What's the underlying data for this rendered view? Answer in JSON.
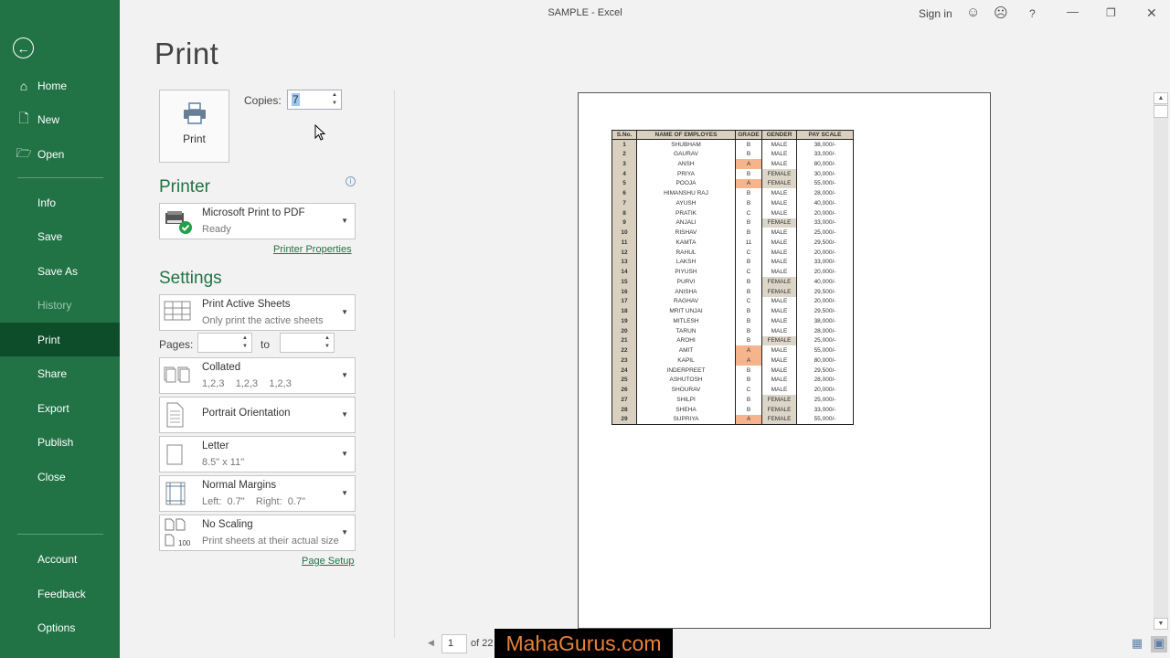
{
  "window": {
    "title": "SAMPLE  -  Excel",
    "sign_in": "Sign in",
    "icons": [
      "smiley-icon",
      "frown-icon",
      "help-icon",
      "minimize-icon",
      "restore-icon",
      "close-icon"
    ],
    "help_glyph": "?"
  },
  "sidebar": {
    "back_label": "Back",
    "items": [
      {
        "label": "Home",
        "icon": "home-icon"
      },
      {
        "label": "New",
        "icon": "new-document-icon"
      },
      {
        "label": "Open",
        "icon": "open-folder-icon"
      },
      {
        "label": "Info"
      },
      {
        "label": "Save"
      },
      {
        "label": "Save As"
      },
      {
        "label": "History",
        "disabled": true
      },
      {
        "label": "Print",
        "active": true
      },
      {
        "label": "Share"
      },
      {
        "label": "Export"
      },
      {
        "label": "Publish"
      },
      {
        "label": "Close"
      },
      {
        "label": "Account"
      },
      {
        "label": "Feedback"
      },
      {
        "label": "Options"
      }
    ]
  },
  "print": {
    "title": "Print",
    "print_button": "Print",
    "copies_label": "Copies:",
    "copies_value": "7",
    "printer_heading": "Printer",
    "printer_name": "Microsoft Print to PDF",
    "printer_status": "Ready",
    "printer_properties": "Printer Properties",
    "settings_heading": "Settings",
    "settings": {
      "scope": {
        "title": "Print Active Sheets",
        "sub": "Only print the active sheets"
      },
      "pages_label": "Pages:",
      "pages_from": "",
      "to_label": "to",
      "pages_to": "",
      "collate": {
        "title": "Collated",
        "sub": "1,2,3    1,2,3    1,2,3"
      },
      "orientation": {
        "title": "Portrait Orientation"
      },
      "paper": {
        "title": "Letter",
        "sub": "8.5\" x 11\""
      },
      "margins": {
        "title": "Normal Margins",
        "sub": "Left:  0.7\"    Right:  0.7\""
      },
      "scaling": {
        "title": "No Scaling",
        "sub": "Print sheets at their actual size",
        "icon_label": "100"
      }
    },
    "page_setup": "Page Setup"
  },
  "preview": {
    "current_page": "1",
    "of_pages": "of 22",
    "watermark": "MahaGurus.com",
    "colors": {
      "header_fill": "#d9d0bf",
      "grade_a_fill": "#f5b48b",
      "female_fill": "#dcd6c8"
    },
    "table": {
      "headers": [
        "S.No.",
        "NAME OF EMPLOYES",
        "GRADE",
        "GENDER",
        "PAY SCALE"
      ],
      "rows": [
        [
          "1",
          "SHUBHAM",
          "B",
          "MALE",
          "38,000/-"
        ],
        [
          "2",
          "GAURAV",
          "B",
          "MALE",
          "33,000/-"
        ],
        [
          "3",
          "ANSH",
          "A",
          "MALE",
          "80,000/-"
        ],
        [
          "4",
          "PRIYA",
          "B",
          "FEMALE",
          "30,000/-"
        ],
        [
          "5",
          "POOJA",
          "A",
          "FEMALE",
          "55,000/-"
        ],
        [
          "6",
          "HIMANSHU RAJ",
          "B",
          "MALE",
          "28,000/-"
        ],
        [
          "7",
          "AYUSH",
          "B",
          "MALE",
          "40,000/-"
        ],
        [
          "8",
          "PRATIK",
          "C",
          "MALE",
          "20,000/-"
        ],
        [
          "9",
          "ANJALI",
          "B",
          "FEMALE",
          "33,000/-"
        ],
        [
          "10",
          "RISHAV",
          "B",
          "MALE",
          "25,000/-"
        ],
        [
          "11",
          "KAMTA",
          "11",
          "MALE",
          "29,500/-"
        ],
        [
          "12",
          "RAHUL",
          "C",
          "MALE",
          "20,000/-"
        ],
        [
          "13",
          "LAKSH",
          "B",
          "MALE",
          "33,000/-"
        ],
        [
          "14",
          "PIYUSH",
          "C",
          "MALE",
          "20,000/-"
        ],
        [
          "15",
          "PURVI",
          "B",
          "FEMALE",
          "40,000/-"
        ],
        [
          "16",
          "ANISHA",
          "B",
          "FEMALE",
          "29,500/-"
        ],
        [
          "17",
          "RAGHAV",
          "C",
          "MALE",
          "20,000/-"
        ],
        [
          "18",
          "MRIT UNJAI",
          "B",
          "MALE",
          "29,500/-"
        ],
        [
          "19",
          "MITLESH",
          "B",
          "MALE",
          "38,000/-"
        ],
        [
          "20",
          "TARUN",
          "B",
          "MALE",
          "28,000/-"
        ],
        [
          "21",
          "AROHI",
          "B",
          "FEMALE",
          "25,000/-"
        ],
        [
          "22",
          "AMIT",
          "A",
          "MALE",
          "55,000/-"
        ],
        [
          "23",
          "KAPIL",
          "A",
          "MALE",
          "80,000/-"
        ],
        [
          "24",
          "INDERPREET",
          "B",
          "MALE",
          "29,500/-"
        ],
        [
          "25",
          "ASHUTOSH",
          "B",
          "MALE",
          "28,000/-"
        ],
        [
          "26",
          "SHOURAV",
          "C",
          "MALE",
          "20,000/-"
        ],
        [
          "27",
          "SHILPI",
          "B",
          "FEMALE",
          "25,000/-"
        ],
        [
          "28",
          "SHEHA",
          "B",
          "FEMALE",
          "33,000/-"
        ],
        [
          "29",
          "SUPRIYA",
          "A",
          "FEMALE",
          "55,000/-"
        ]
      ]
    }
  }
}
